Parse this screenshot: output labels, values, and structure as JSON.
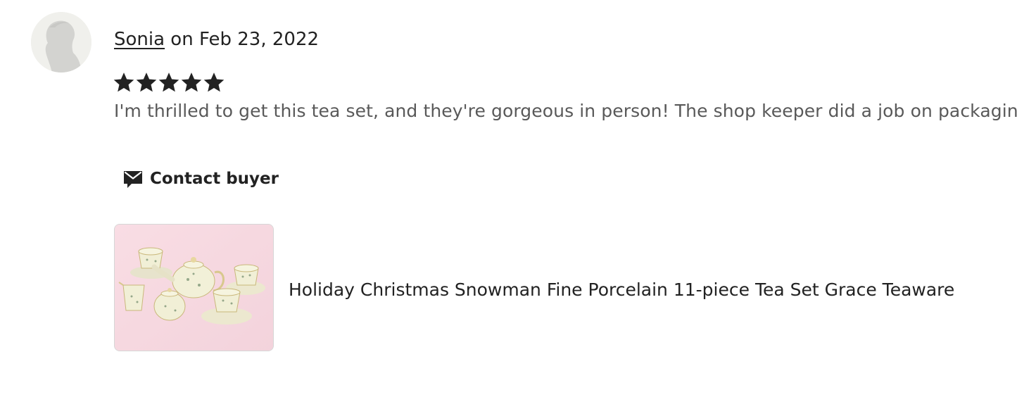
{
  "review": {
    "reviewer_name": "Sonia",
    "date_text": " on Feb 23, 2022",
    "rating": 5,
    "rating_max": 5,
    "text": "I'm thrilled to get this tea set, and they're gorgeous in person! The shop keeper did a job on packaging!"
  },
  "contact": {
    "label": "Contact buyer",
    "icon": "mail-icon"
  },
  "listing": {
    "title": "Holiday Christmas Snowman Fine Porcelain 11-piece Tea Set Grace Teaware"
  },
  "colors": {
    "star": "#222222",
    "review_text": "#595959",
    "avatar_bg": "#f0f0ec"
  }
}
